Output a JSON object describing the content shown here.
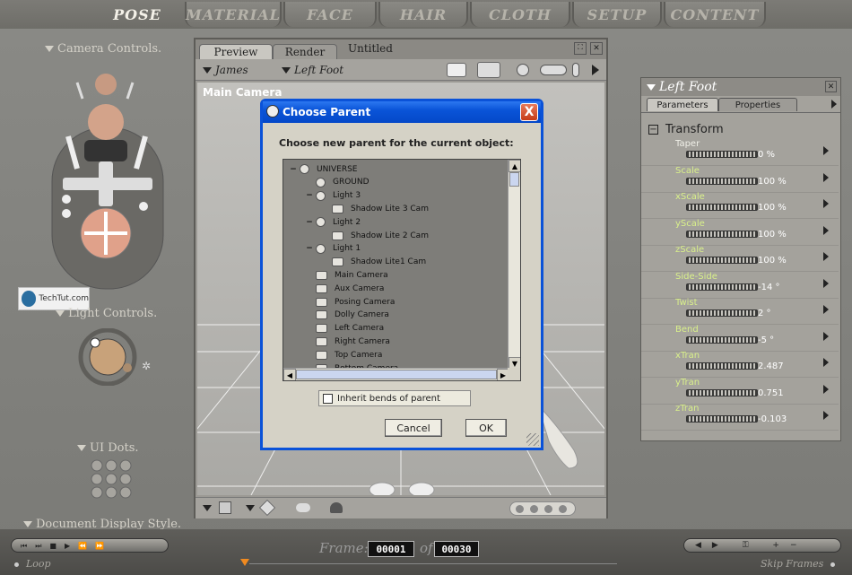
{
  "top_tabs": [
    "POSE",
    "MATERIAL",
    "FACE",
    "HAIR",
    "CLOTH",
    "SETUP",
    "CONTENT"
  ],
  "left_panel": {
    "camera_controls": "Camera Controls.",
    "light_controls": "Light Controls.",
    "ui_dots": "UI Dots.",
    "document_display_style": "Document Display Style.",
    "watermark": "TechTut.com"
  },
  "viewport": {
    "tabs": [
      "Preview",
      "Render"
    ],
    "doc_title": "Untitled",
    "figure_select": "James",
    "part_select": "Left Foot",
    "camera_label": "Main Camera"
  },
  "dialog": {
    "title": "Choose Parent",
    "close": "X",
    "prompt": "Choose new parent for the current object:",
    "tree": [
      {
        "label": "UNIVERSE",
        "level": 0,
        "expander": "−",
        "icon": "universe-icon"
      },
      {
        "label": "GROUND",
        "level": 1,
        "expander": "",
        "icon": "ground-icon"
      },
      {
        "label": "Light 3",
        "level": 1,
        "expander": "−",
        "icon": "light-icon"
      },
      {
        "label": "Shadow Lite 3 Cam",
        "level": 2,
        "expander": "",
        "icon": "camera-icon"
      },
      {
        "label": "Light 2",
        "level": 1,
        "expander": "−",
        "icon": "light-icon"
      },
      {
        "label": "Shadow Lite 2 Cam",
        "level": 2,
        "expander": "",
        "icon": "camera-icon"
      },
      {
        "label": "Light 1",
        "level": 1,
        "expander": "−",
        "icon": "light-icon"
      },
      {
        "label": "Shadow Lite1 Cam",
        "level": 2,
        "expander": "",
        "icon": "camera-icon"
      },
      {
        "label": "Main Camera",
        "level": 1,
        "expander": "",
        "icon": "camera-icon"
      },
      {
        "label": "Aux Camera",
        "level": 1,
        "expander": "",
        "icon": "camera-icon"
      },
      {
        "label": "Posing Camera",
        "level": 1,
        "expander": "",
        "icon": "camera-icon"
      },
      {
        "label": "Dolly Camera",
        "level": 1,
        "expander": "",
        "icon": "camera-icon"
      },
      {
        "label": "Left Camera",
        "level": 1,
        "expander": "",
        "icon": "camera-icon"
      },
      {
        "label": "Right Camera",
        "level": 1,
        "expander": "",
        "icon": "camera-icon"
      },
      {
        "label": "Top Camera",
        "level": 1,
        "expander": "",
        "icon": "camera-icon"
      },
      {
        "label": "Bottom Camera",
        "level": 1,
        "expander": "",
        "icon": "camera-icon"
      }
    ],
    "checkbox_label": "Inherit bends of parent",
    "checkbox_checked": false,
    "cancel": "Cancel",
    "ok": "OK"
  },
  "right_panel": {
    "title": "Left Foot",
    "tabs": [
      "Parameters",
      "Properties"
    ],
    "group": "Transform",
    "params": [
      {
        "name": "Taper",
        "value": "0 %"
      },
      {
        "name": "Scale",
        "value": "100 %"
      },
      {
        "name": "xScale",
        "value": "100 %"
      },
      {
        "name": "yScale",
        "value": "100 %"
      },
      {
        "name": "zScale",
        "value": "100 %"
      },
      {
        "name": "Side-Side",
        "value": "-14 °"
      },
      {
        "name": "Twist",
        "value": "2 °"
      },
      {
        "name": "Bend",
        "value": "-5 °"
      },
      {
        "name": "xTran",
        "value": "2.487"
      },
      {
        "name": "yTran",
        "value": "0.751"
      },
      {
        "name": "zTran",
        "value": "-0.103"
      }
    ]
  },
  "animation": {
    "frame_label": "Frame:",
    "current_frame": "00001",
    "of_label": "of",
    "total_frames": "00030",
    "loop": "Loop",
    "skip_frames": "Skip Frames"
  },
  "colors": {
    "param_name": "#d9f08a",
    "dialog_title": "#0a54d8",
    "accent": "#f4f1e8"
  }
}
